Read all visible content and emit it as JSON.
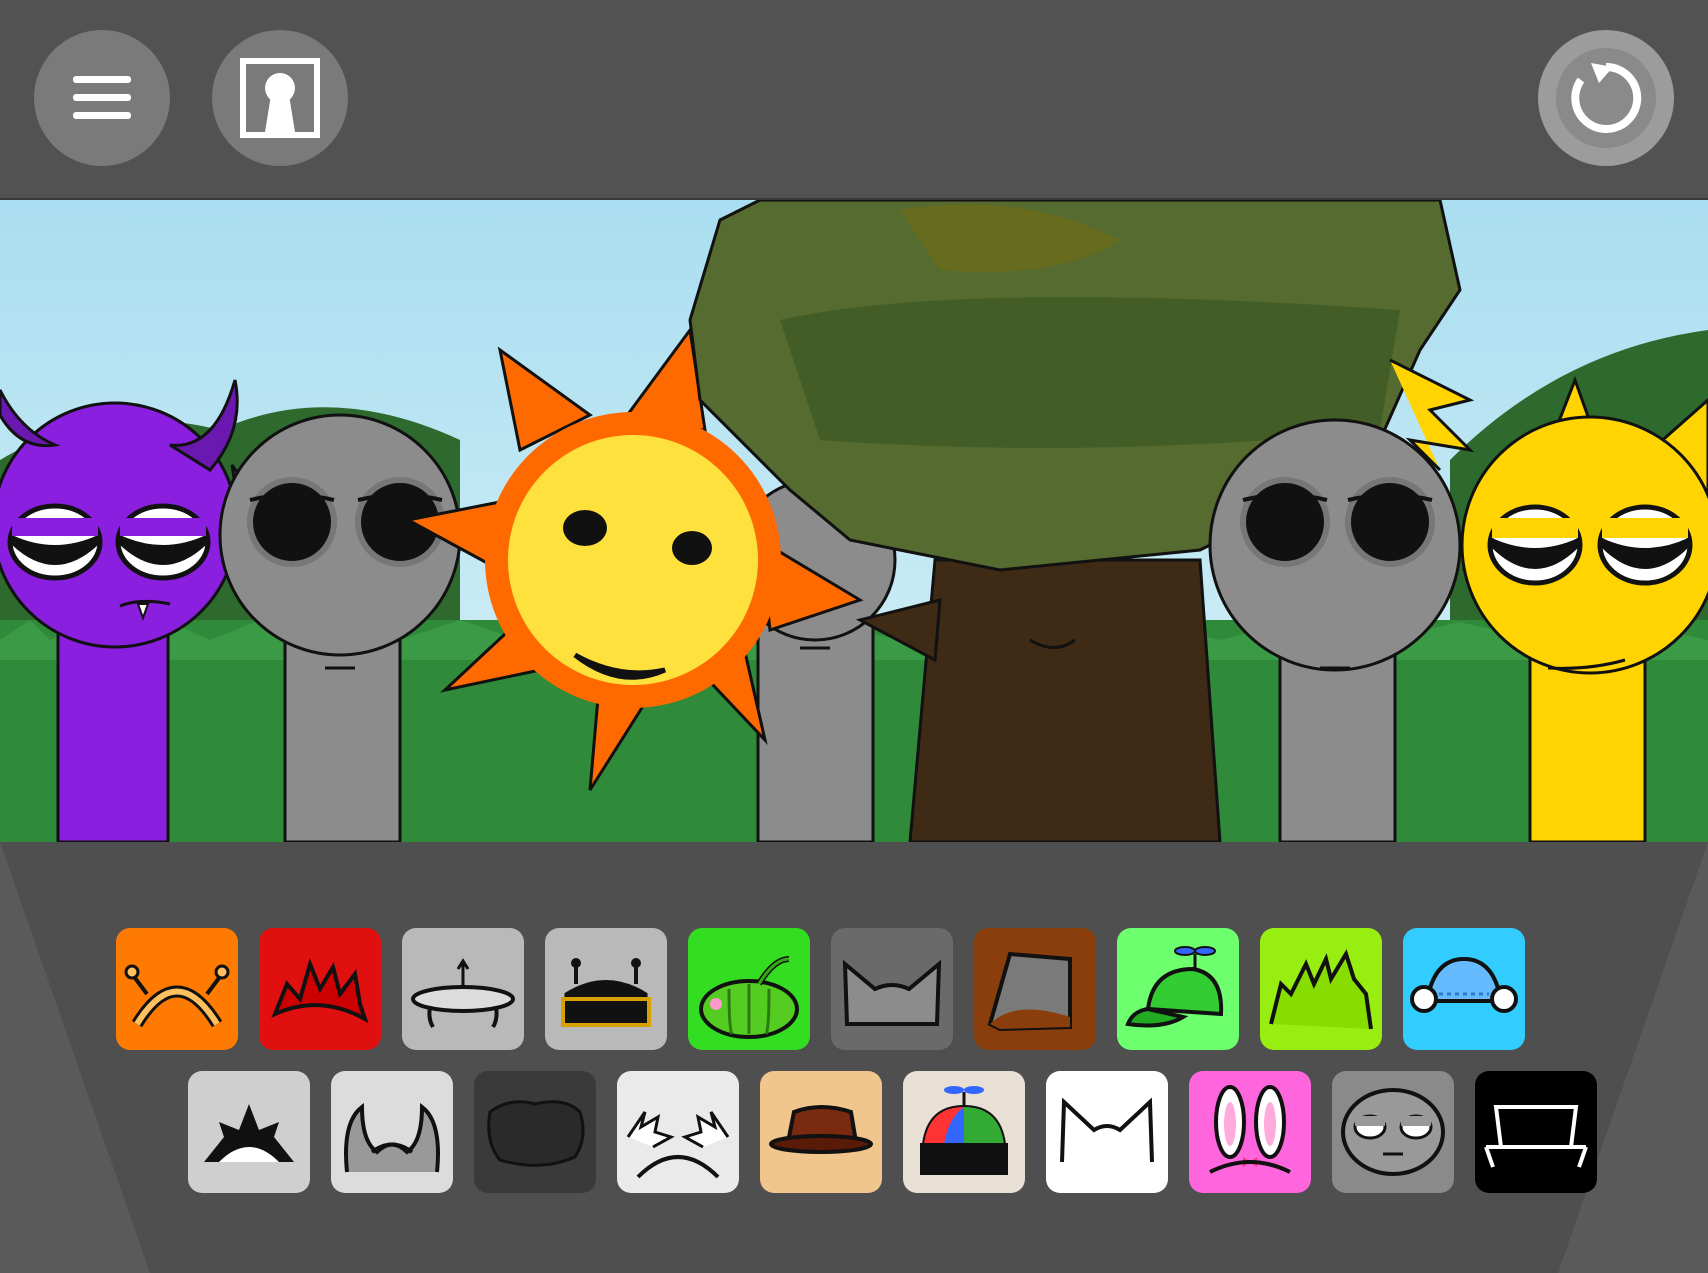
{
  "toolbar": {
    "menu_icon": "hamburger-menu-icon",
    "unlock_icon": "keyhole-icon",
    "reset_icon": "reset-arrow-icon"
  },
  "stage": {
    "characters": [
      {
        "name": "purple-devil",
        "color": "#8a1fe0"
      },
      {
        "name": "gray-idle-1",
        "color": "#8c8c8c"
      },
      {
        "name": "sun",
        "color": "#ffe13d",
        "ray_color": "#ff6a00"
      },
      {
        "name": "gray-idle-2",
        "color": "#8c8c8c"
      },
      {
        "name": "tree",
        "color": "#3f2a16",
        "leaf_color": "#556b2f"
      },
      {
        "name": "gray-idle-3",
        "color": "#8c8c8c"
      },
      {
        "name": "yellow-spiky",
        "color": "#ffd400"
      }
    ]
  },
  "palette": {
    "row1": [
      {
        "icon": "antenna-headband-icon",
        "color": "#ff7a00"
      },
      {
        "icon": "red-spiky-hair-icon",
        "color": "#e01010"
      },
      {
        "icon": "ufo-icon",
        "color": "#b9b9b9"
      },
      {
        "icon": "robot-visor-icon",
        "color": "#b9b9b9"
      },
      {
        "icon": "pumpkin-icon",
        "color": "#33dd22"
      },
      {
        "icon": "cat-ears-gray-icon",
        "color": "#6a6a6a"
      },
      {
        "icon": "bucket-hat-icon",
        "color": "#8a3e0c"
      },
      {
        "icon": "propeller-cap-green-icon",
        "color": "#6dff6d"
      },
      {
        "icon": "green-spiky-hair-icon",
        "color": "#99ee11"
      },
      {
        "icon": "blue-headphones-icon",
        "color": "#33ccff"
      }
    ],
    "row2": [
      {
        "icon": "crown-spikes-icon",
        "color": "#cfcfcf"
      },
      {
        "icon": "devil-horns-icon",
        "color": "#dcdcdc"
      },
      {
        "icon": "dark-bush-icon",
        "color": "#3a3a3a"
      },
      {
        "icon": "lightning-antennae-icon",
        "color": "#eaeaea"
      },
      {
        "icon": "brown-fedora-icon",
        "color": "#f0c68c"
      },
      {
        "icon": "propeller-beanie-icon",
        "color": "#e8e0d4"
      },
      {
        "icon": "white-cat-ears-icon",
        "color": "#ffffff"
      },
      {
        "icon": "bunny-ears-icon",
        "color": "#ff66dd"
      },
      {
        "icon": "sleepy-face-icon",
        "color": "#8a8a8a"
      },
      {
        "icon": "bench-icon",
        "color": "#000000"
      }
    ]
  }
}
